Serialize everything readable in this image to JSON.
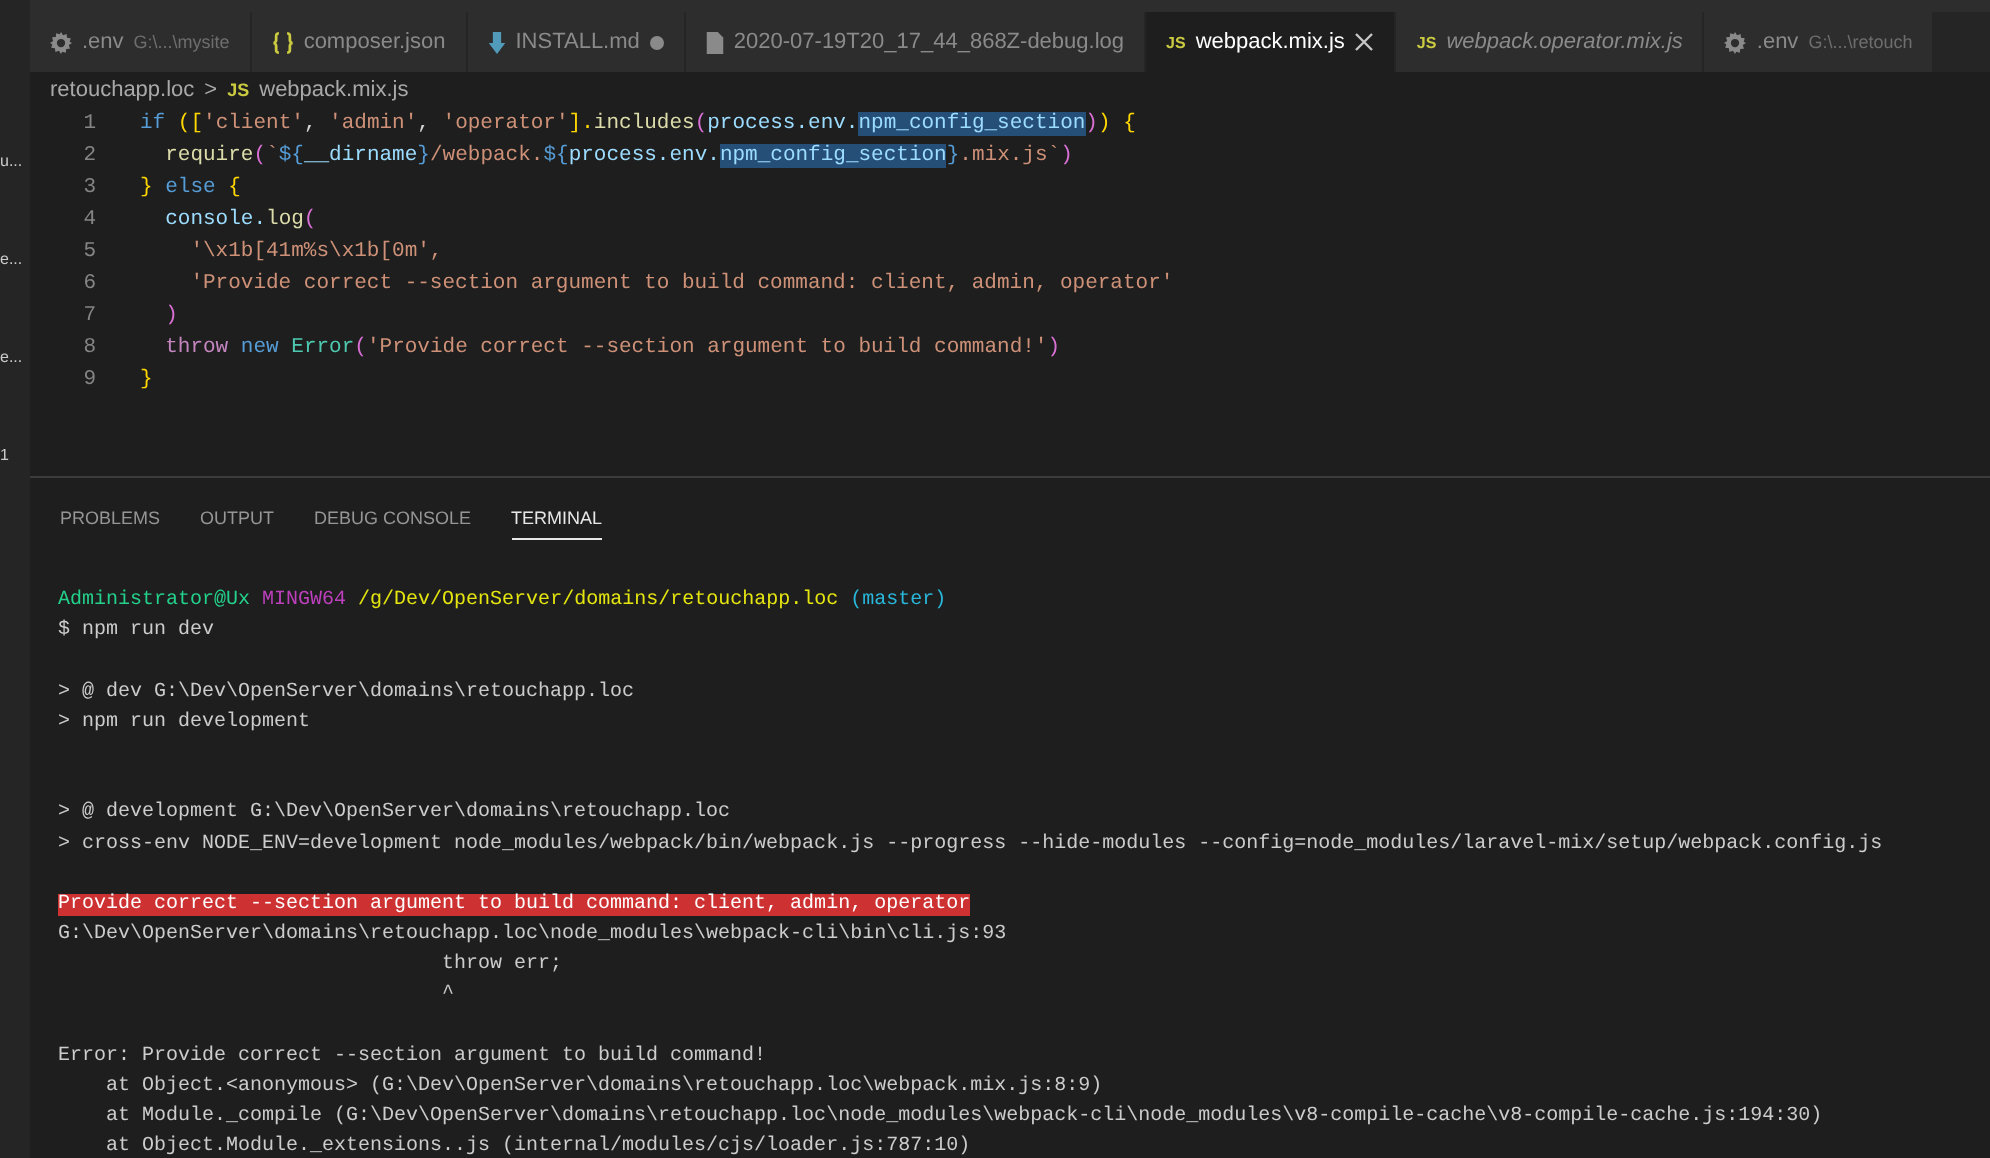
{
  "sidebar_fragments": [
    "u...",
    "e...",
    "e...",
    "1"
  ],
  "tabs": [
    {
      "kind": "settings",
      "label": ".env",
      "detail": "G:\\...\\mysite",
      "selected": false,
      "modified": false,
      "preview": false
    },
    {
      "kind": "json",
      "label": "composer.json",
      "selected": false,
      "modified": false,
      "preview": false
    },
    {
      "kind": "markdown",
      "label": "INSTALL.md",
      "selected": false,
      "modified": true,
      "preview": false
    },
    {
      "kind": "log",
      "label": "2020-07-19T20_17_44_868Z-debug.log",
      "selected": false,
      "modified": false,
      "preview": false
    },
    {
      "kind": "js",
      "badge": "JS",
      "label": "webpack.mix.js",
      "selected": true,
      "modified": false,
      "preview": false
    },
    {
      "kind": "js",
      "badge": "JS",
      "label": "webpack.operator.mix.js",
      "selected": false,
      "modified": false,
      "preview": true
    },
    {
      "kind": "settings",
      "label": ".env",
      "detail": "G:\\...\\retouch",
      "selected": false,
      "modified": false,
      "preview": false
    }
  ],
  "breadcrumb": {
    "folder": "retouchapp.loc",
    "separator": ">",
    "file_icon": "JS",
    "file": "webpack.mix.js"
  },
  "code_lines": [
    {
      "number": "1",
      "tokens": [
        {
          "kind": "keyword",
          "text": "if "
        },
        {
          "kind": "bracket",
          "text": "(["
        },
        {
          "kind": "string",
          "text": "'client'"
        },
        {
          "kind": "plain",
          "text": ", "
        },
        {
          "kind": "string",
          "text": "'admin'"
        },
        {
          "kind": "plain",
          "text": ", "
        },
        {
          "kind": "string",
          "text": "'operator'"
        },
        {
          "kind": "bracket",
          "text": "]."
        },
        {
          "kind": "func",
          "text": "includes"
        },
        {
          "kind": "bracket2",
          "text": "("
        },
        {
          "kind": "var",
          "text": "process.env."
        },
        {
          "kind": "var",
          "text": "npm_config_section",
          "highlighted": true
        },
        {
          "kind": "bracket2",
          "text": ")"
        },
        {
          "kind": "bracket",
          "text": ") {"
        }
      ]
    },
    {
      "number": "2",
      "tokens": [
        {
          "kind": "func",
          "text": "  require"
        },
        {
          "kind": "bracket2",
          "text": "("
        },
        {
          "kind": "string",
          "text": "`"
        },
        {
          "kind": "keyword",
          "text": "${"
        },
        {
          "kind": "var",
          "text": "__dirname"
        },
        {
          "kind": "keyword",
          "text": "}"
        },
        {
          "kind": "string",
          "text": "/webpack."
        },
        {
          "kind": "keyword",
          "text": "${"
        },
        {
          "kind": "var",
          "text": "process.env."
        },
        {
          "kind": "var",
          "text": "npm_config_section",
          "highlighted": true
        },
        {
          "kind": "keyword",
          "text": "}"
        },
        {
          "kind": "string",
          "text": ".mix.js`"
        },
        {
          "kind": "bracket2",
          "text": ")"
        }
      ]
    },
    {
      "number": "3",
      "tokens": [
        {
          "kind": "bracket",
          "text": "} "
        },
        {
          "kind": "keyword",
          "text": "else "
        },
        {
          "kind": "bracket",
          "text": "{"
        }
      ]
    },
    {
      "number": "4",
      "tokens": [
        {
          "kind": "var",
          "text": "  console."
        },
        {
          "kind": "func",
          "text": "log"
        },
        {
          "kind": "bracket2",
          "text": "("
        }
      ]
    },
    {
      "number": "5",
      "tokens": [
        {
          "kind": "string",
          "text": "    '\\x1b[41m%s\\x1b[0m',"
        }
      ]
    },
    {
      "number": "6",
      "tokens": [
        {
          "kind": "string",
          "text": "    'Provide correct --section argument to build command: client, admin, operator'"
        }
      ]
    },
    {
      "number": "7",
      "tokens": [
        {
          "kind": "bracket2",
          "text": "  )"
        }
      ]
    },
    {
      "number": "8",
      "tokens": [
        {
          "kind": "control",
          "text": "  throw "
        },
        {
          "kind": "new",
          "text": "new "
        },
        {
          "kind": "class",
          "text": "Error"
        },
        {
          "kind": "bracket2",
          "text": "("
        },
        {
          "kind": "string",
          "text": "'Provide correct --section argument to build command!'"
        },
        {
          "kind": "bracket2",
          "text": ")"
        }
      ]
    },
    {
      "number": "9",
      "tokens": [
        {
          "kind": "bracket",
          "text": "}"
        }
      ]
    }
  ],
  "panel_tabs": [
    {
      "label": "PROBLEMS",
      "selected": false
    },
    {
      "label": "OUTPUT",
      "selected": false
    },
    {
      "label": "DEBUG CONSOLE",
      "selected": false
    },
    {
      "label": "TERMINAL",
      "selected": true
    }
  ],
  "terminal_lines": [
    {
      "kind": "line",
      "segments": [
        {
          "kind": "user",
          "text": "Administrator@Ux "
        },
        {
          "kind": "system",
          "text": "MINGW64 "
        },
        {
          "kind": "path",
          "text": "/g/Dev/OpenServer/domains/retouchapp.loc "
        },
        {
          "kind": "branch",
          "text": "(master)"
        }
      ]
    },
    {
      "kind": "line",
      "segments": [
        {
          "kind": "plain",
          "text": "$ npm run dev"
        }
      ]
    },
    {
      "kind": "after_gap",
      "segments": [
        {
          "kind": "plain",
          "text": "> @ dev G:\\Dev\\OpenServer\\domains\\retouchapp.loc"
        }
      ]
    },
    {
      "kind": "line",
      "segments": [
        {
          "kind": "plain",
          "text": "> npm run development"
        }
      ]
    },
    {
      "kind": "after_wide_gap",
      "segments": [
        {
          "kind": "plain",
          "text": "> @ development G:\\Dev\\OpenServer\\domains\\retouchapp.loc"
        }
      ]
    },
    {
      "kind": "line",
      "segments": [
        {
          "kind": "plain",
          "text": "> cross-env NODE_ENV=development node_modules/webpack/bin/webpack.js --progress --hide-modules --config=node_modules/laravel-mix/setup/webpack.config.js"
        }
      ]
    },
    {
      "kind": "after_gap",
      "segments": [
        {
          "kind": "error",
          "text": "Provide correct --section argument to build command: client, admin, operator"
        }
      ]
    },
    {
      "kind": "line",
      "segments": [
        {
          "kind": "plain",
          "text": "G:\\Dev\\OpenServer\\domains\\retouchapp.loc\\node_modules\\webpack-cli\\bin\\cli.js:93"
        }
      ]
    },
    {
      "kind": "line",
      "segments": [
        {
          "kind": "plain",
          "text": "                                throw err;"
        }
      ]
    },
    {
      "kind": "line",
      "segments": [
        {
          "kind": "plain",
          "text": "                                ^"
        }
      ]
    },
    {
      "kind": "after_gap",
      "segments": [
        {
          "kind": "plain",
          "text": "Error: Provide correct --section argument to build command!"
        }
      ]
    },
    {
      "kind": "line",
      "segments": [
        {
          "kind": "plain",
          "text": "    at Object.<anonymous> (G:\\Dev\\OpenServer\\domains\\retouchapp.loc\\webpack.mix.js:8:9)"
        }
      ]
    },
    {
      "kind": "line",
      "segments": [
        {
          "kind": "plain",
          "text": "    at Module._compile (G:\\Dev\\OpenServer\\domains\\retouchapp.loc\\node_modules\\webpack-cli\\node_modules\\v8-compile-cache\\v8-compile-cache.js:194:30)"
        }
      ]
    },
    {
      "kind": "line",
      "segments": [
        {
          "kind": "plain",
          "text": "    at Object.Module._extensions..js (internal/modules/cjs/loader.js:787:10)"
        }
      ]
    }
  ]
}
